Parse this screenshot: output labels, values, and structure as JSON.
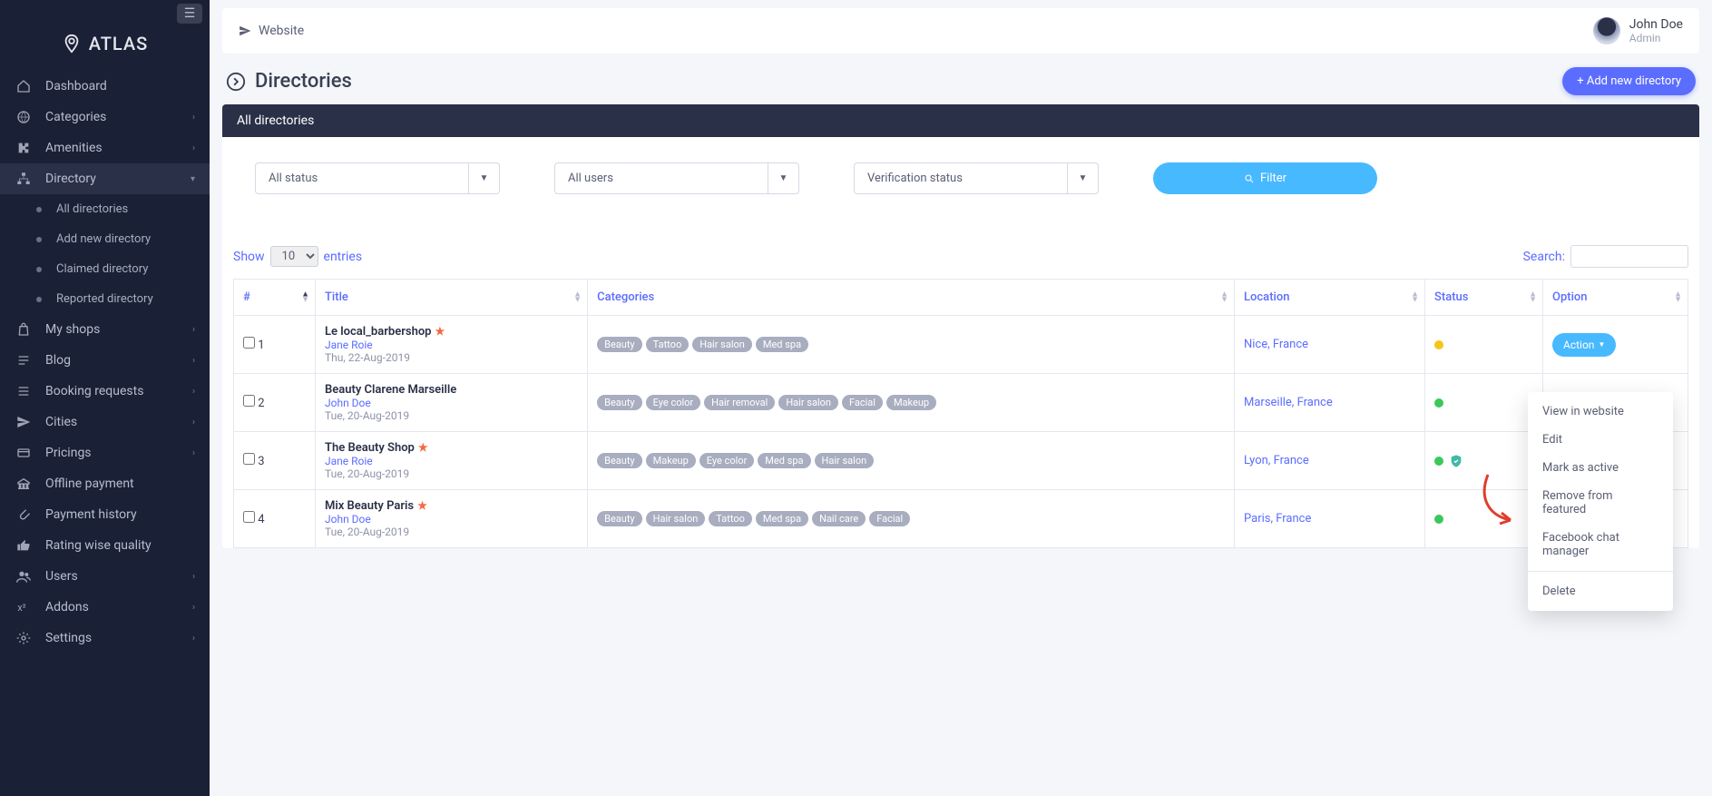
{
  "logo": "ATLAS",
  "topbar": {
    "website_link": "Website"
  },
  "user": {
    "name": "John Doe",
    "role": "Admin"
  },
  "page": {
    "title": "Directories",
    "add_btn": "+ Add new directory"
  },
  "panel": {
    "title": "All directories"
  },
  "sidebar": {
    "items": [
      {
        "label": "Dashboard",
        "icon": "home",
        "expandable": false
      },
      {
        "label": "Categories",
        "icon": "grid",
        "expandable": true
      },
      {
        "label": "Amenities",
        "icon": "puzzle",
        "expandable": true
      },
      {
        "label": "Directory",
        "icon": "sitemap",
        "expandable": true,
        "active": true,
        "children": [
          {
            "label": "All directories"
          },
          {
            "label": "Add new directory"
          },
          {
            "label": "Claimed directory"
          },
          {
            "label": "Reported directory"
          }
        ]
      },
      {
        "label": "My shops",
        "icon": "bag",
        "expandable": true
      },
      {
        "label": "Blog",
        "icon": "lines",
        "expandable": true
      },
      {
        "label": "Booking requests",
        "icon": "list",
        "expandable": true
      },
      {
        "label": "Cities",
        "icon": "send",
        "expandable": true
      },
      {
        "label": "Pricings",
        "icon": "card",
        "expandable": true
      },
      {
        "label": "Offline payment",
        "icon": "bank",
        "expandable": false
      },
      {
        "label": "Payment history",
        "icon": "clip",
        "expandable": false
      },
      {
        "label": "Rating wise quality",
        "icon": "thumb",
        "expandable": false
      },
      {
        "label": "Users",
        "icon": "users",
        "expandable": true
      },
      {
        "label": "Addons",
        "icon": "sup",
        "expandable": true
      },
      {
        "label": "Settings",
        "icon": "gear",
        "expandable": true
      }
    ]
  },
  "filters": {
    "status": "All status",
    "users": "All users",
    "verification": "Verification status",
    "btn": "Filter"
  },
  "table_ctrl": {
    "show": "Show",
    "entries": "entries",
    "per_page": "10",
    "search_label": "Search:"
  },
  "columns": [
    "#",
    "Title",
    "Categories",
    "Location",
    "Status",
    "Option"
  ],
  "rows": [
    {
      "n": "1",
      "title": "Le local_barbershop",
      "starred": true,
      "user": "Jane Roie",
      "date": "Thu, 22-Aug-2019",
      "cats": [
        "Beauty",
        "Tattoo",
        "Hair salon",
        "Med spa"
      ],
      "loc": "Nice, France",
      "status": "pending",
      "shield": false,
      "actionOpen": true
    },
    {
      "n": "2",
      "title": "Beauty Clarene Marseille",
      "starred": false,
      "user": "John Doe",
      "date": "Tue, 20-Aug-2019",
      "cats": [
        "Beauty",
        "Eye color",
        "Hair removal",
        "Hair salon",
        "Facial",
        "Makeup"
      ],
      "loc": "Marseille, France",
      "status": "active",
      "shield": false,
      "actionOpen": false
    },
    {
      "n": "3",
      "title": "The Beauty Shop",
      "starred": true,
      "user": "Jane Roie",
      "date": "Tue, 20-Aug-2019",
      "cats": [
        "Beauty",
        "Makeup",
        "Eye color",
        "Med spa",
        "Hair salon"
      ],
      "loc": "Lyon, France",
      "status": "active",
      "shield": true,
      "actionOpen": false
    },
    {
      "n": "4",
      "title": "Mix Beauty Paris",
      "starred": true,
      "user": "John Doe",
      "date": "Tue, 20-Aug-2019",
      "cats": [
        "Beauty",
        "Hair salon",
        "Tattoo",
        "Med spa",
        "Nail care",
        "Facial"
      ],
      "loc": "Paris, France",
      "status": "active",
      "shield": false,
      "actionOpen": false
    }
  ],
  "action_label": "Action",
  "dropdown": {
    "items": [
      "View in website",
      "Edit",
      "Mark as active",
      "Remove from featured",
      "Facebook chat manager"
    ],
    "delete": "Delete"
  }
}
